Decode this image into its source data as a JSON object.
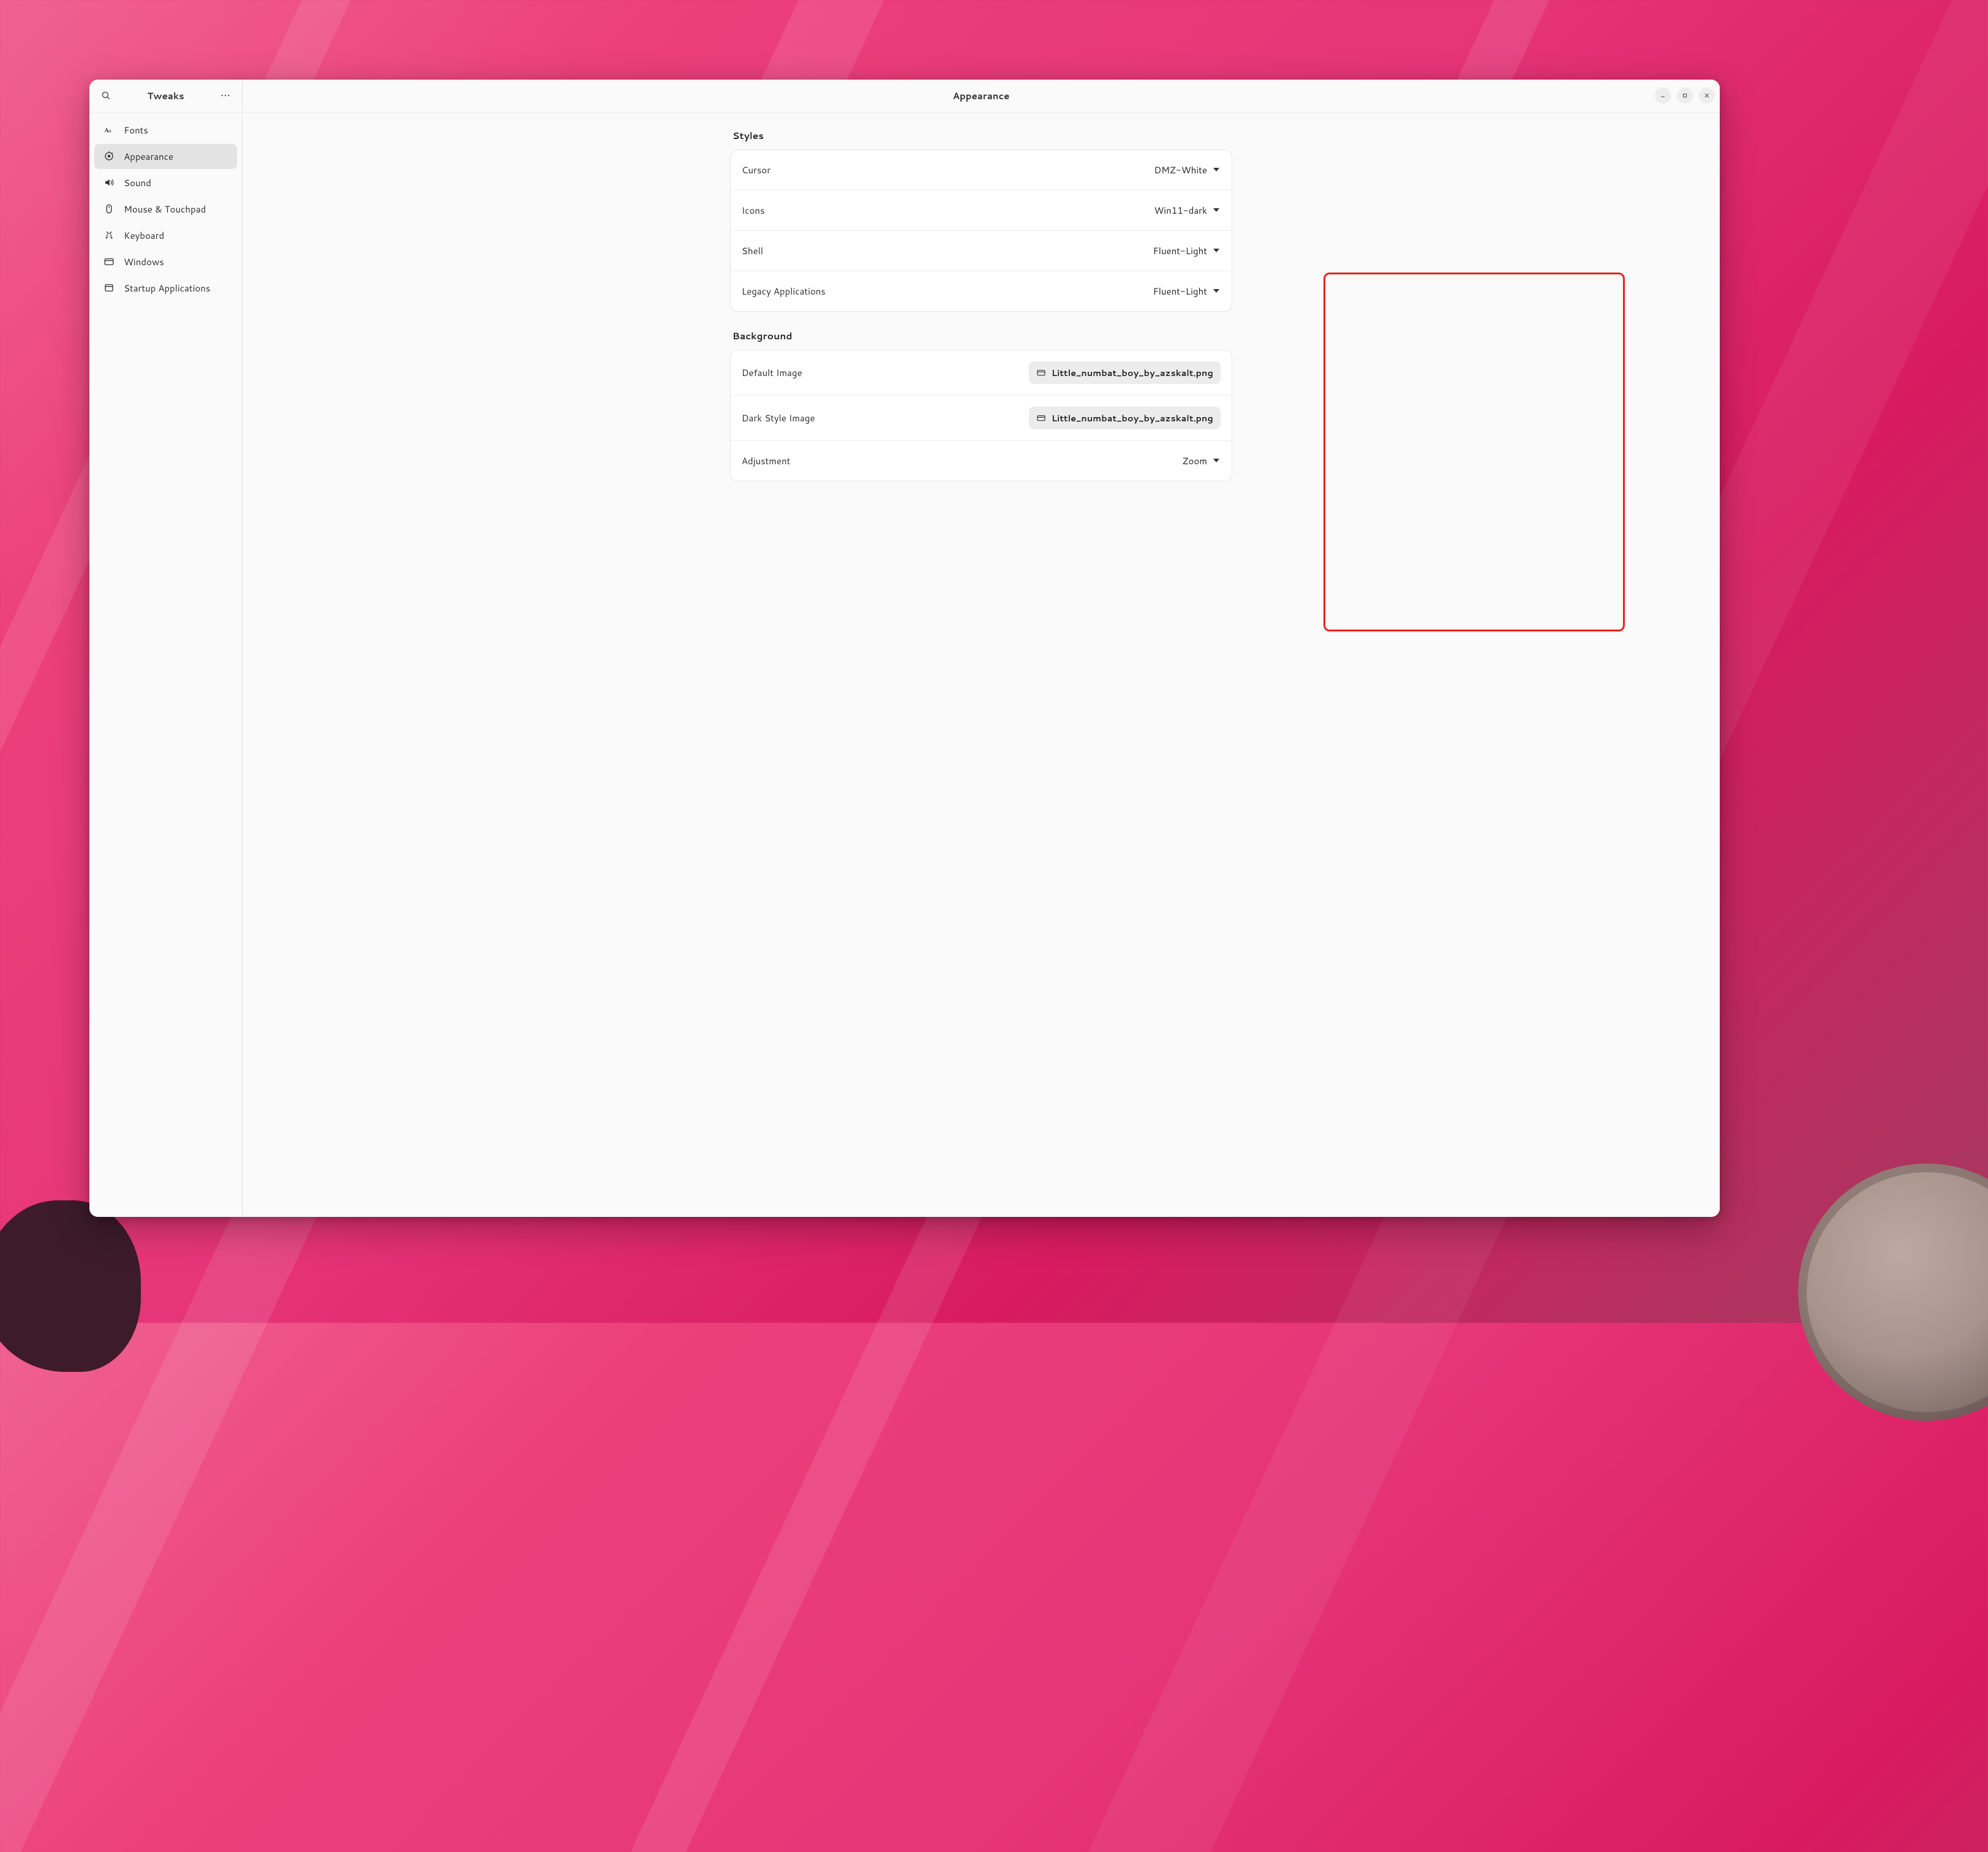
{
  "app_title": "Tweaks",
  "page_title": "Appearance",
  "sidebar": {
    "items": [
      {
        "label": "Fonts",
        "icon": "fonts-icon"
      },
      {
        "label": "Appearance",
        "icon": "appearance-icon",
        "active": true
      },
      {
        "label": "Sound",
        "icon": "sound-icon"
      },
      {
        "label": "Mouse & Touchpad",
        "icon": "mouse-icon"
      },
      {
        "label": "Keyboard",
        "icon": "keyboard-icon"
      },
      {
        "label": "Windows",
        "icon": "windows-icon"
      },
      {
        "label": "Startup Applications",
        "icon": "startup-icon"
      }
    ]
  },
  "sections": {
    "styles": {
      "title": "Styles",
      "rows": [
        {
          "label": "Cursor",
          "value": "DMZ-White"
        },
        {
          "label": "Icons",
          "value": "Win11-dark"
        },
        {
          "label": "Shell",
          "value": "Fluent-Light"
        },
        {
          "label": "Legacy Applications",
          "value": "Fluent-Light"
        }
      ]
    },
    "background": {
      "title": "Background",
      "rows": [
        {
          "label": "Default Image",
          "file": "Little_numbat_boy_by_azskalt.png"
        },
        {
          "label": "Dark Style Image",
          "file": "Little_numbat_boy_by_azskalt.png"
        },
        {
          "label": "Adjustment",
          "value": "Zoom"
        }
      ]
    }
  },
  "highlight": {
    "description": "Red annotation rectangle around the Styles dropdown values column"
  }
}
